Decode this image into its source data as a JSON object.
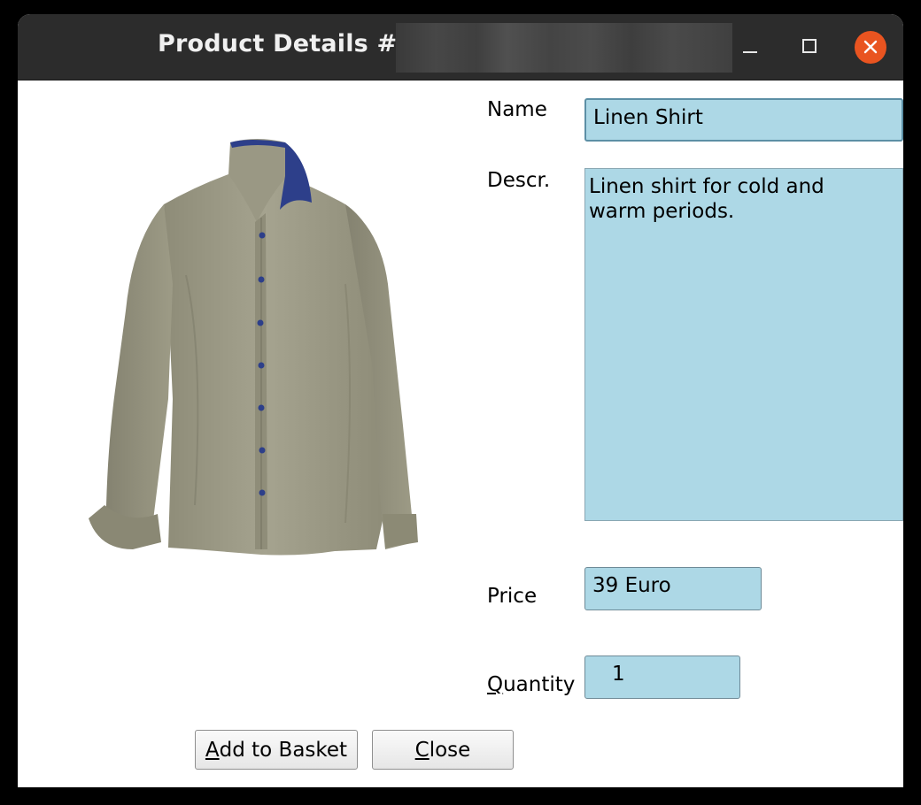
{
  "window": {
    "title": "Product Details #1",
    "controls": {
      "minimize": "minimize-icon",
      "maximize": "maximize-icon",
      "close": "close-icon",
      "close_color": "#e95420"
    }
  },
  "form": {
    "name_label": "Name",
    "name_value": "Linen Shirt",
    "descr_label": "Descr.",
    "descr_value": "Linen shirt for cold and\nwarm periods.",
    "price_label": "Price",
    "price_value": "39 Euro",
    "quantity_label_mnemonic": "Q",
    "quantity_label_rest": "uantity",
    "quantity_value": "1",
    "field_color": "#add8e6"
  },
  "buttons": {
    "add_mnemonic": "A",
    "add_rest": "dd to Basket",
    "close_pre": " ",
    "close_mnemonic": "C",
    "close_rest": "lose"
  },
  "image": {
    "subject": "shirt-image",
    "shirt_color": "#9c9a86",
    "button_color": "#2d3f8a"
  }
}
